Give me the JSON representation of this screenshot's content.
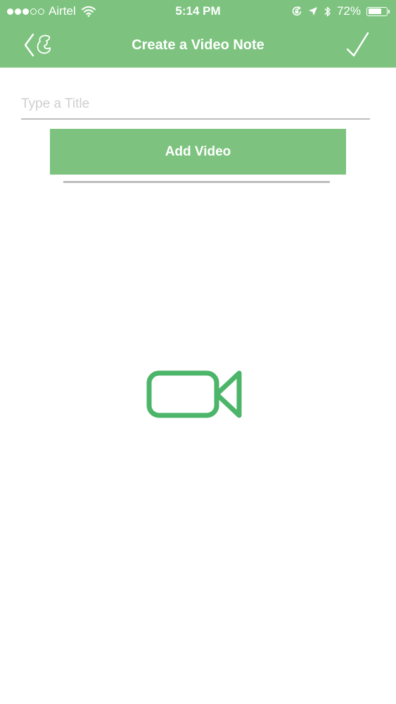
{
  "status_bar": {
    "carrier": "Airtel",
    "time": "5:14 PM",
    "battery_percent": "72%",
    "battery_level": 0.72,
    "signal_bars_filled": 3,
    "signal_bars_total": 5,
    "icons": [
      "wifi-icon",
      "orientation-lock-icon",
      "location-arrow-icon",
      "bluetooth-icon",
      "battery-icon"
    ]
  },
  "nav": {
    "title": "Create a Video Note",
    "back_icon": "back-chevron-icon",
    "done_icon": "checkmark-icon"
  },
  "form": {
    "title_placeholder": "Type a Title",
    "title_value": "",
    "add_video_label": "Add Video"
  },
  "media": {
    "placeholder_icon": "video-camera-icon"
  },
  "colors": {
    "brand_green": "#7dc37f",
    "icon_green": "#4cb56a",
    "input_underline": "#bdbdbd",
    "placeholder_text": "#cfcfcf"
  }
}
